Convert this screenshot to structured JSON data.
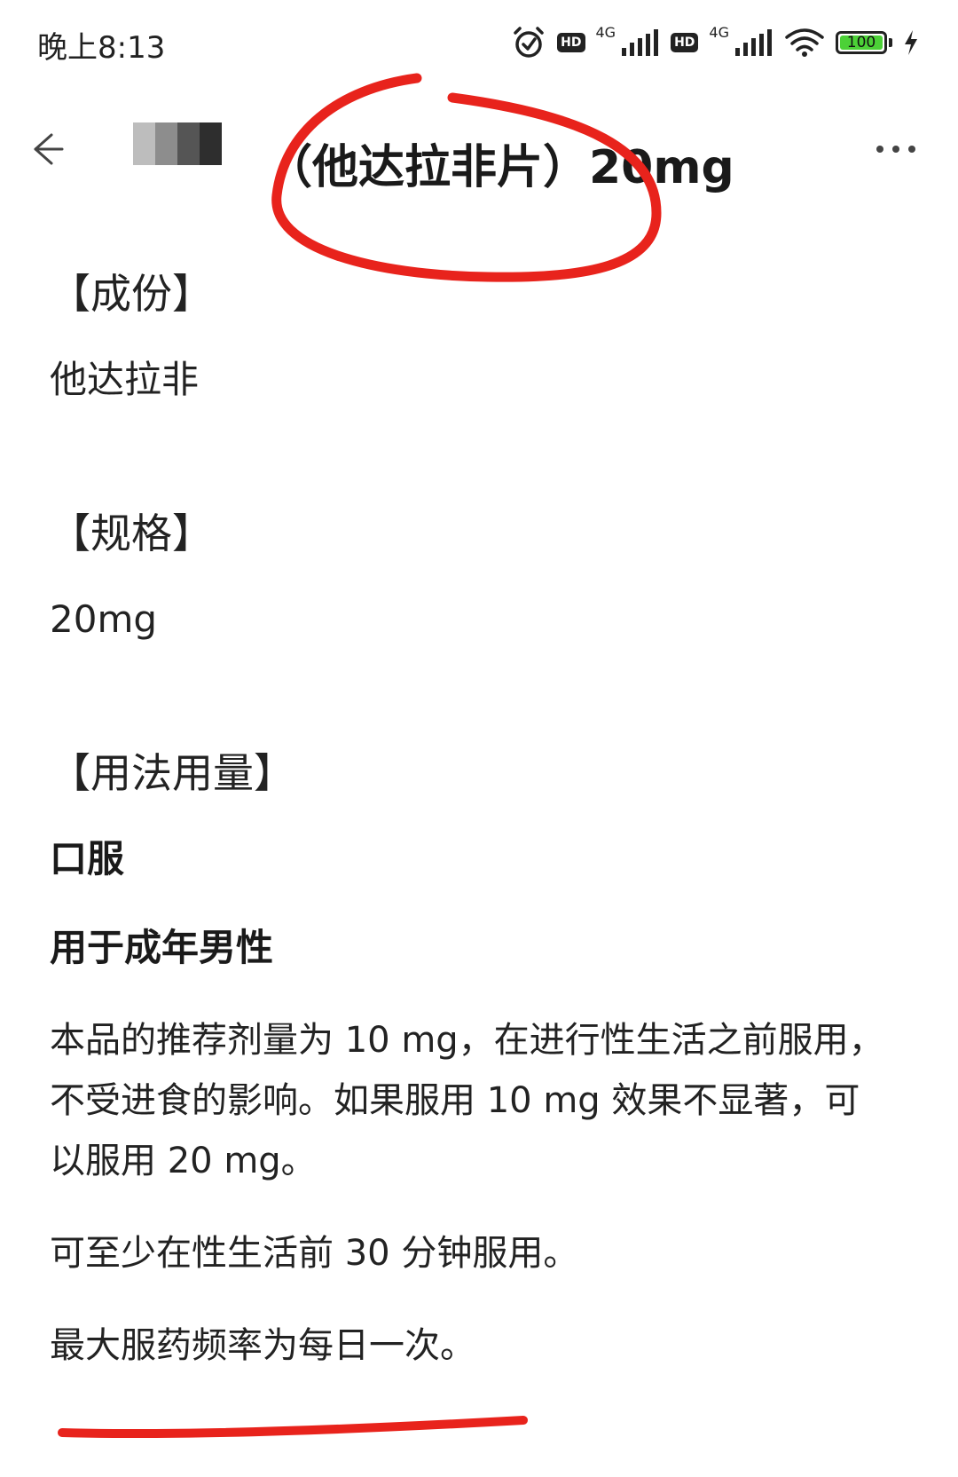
{
  "status_bar": {
    "time": "晚上8:13",
    "hd_label": "HD",
    "network_label": "4G",
    "battery_level": "100",
    "battery_fraction": 1.0
  },
  "nav": {
    "title": "（他达拉非片）20mg"
  },
  "sections": {
    "ingredient_heading": "【成份】",
    "ingredient_value": "他达拉非",
    "spec_heading": "【规格】",
    "spec_value": "20mg",
    "usage_heading": "【用法用量】",
    "usage_route": "口服",
    "usage_target": "用于成年男性",
    "para_1": "本品的推荐剂量为 10 mg，在进行性生活之前服用，不受进食的影响。如果服用 10 mg 效果不显著，可以服用 20 mg。",
    "para_2": "可至少在性生活前 30 分钟服用。",
    "para_3": "最大服药频率为每日一次。"
  },
  "colors": {
    "annotation_red": "#e8231c",
    "battery_green": "#4cd137",
    "text": "#222222"
  },
  "icons": [
    "alarm-icon",
    "signal-icon",
    "wifi-icon",
    "battery-icon",
    "charging-icon",
    "back-arrow-icon",
    "more-icon"
  ]
}
